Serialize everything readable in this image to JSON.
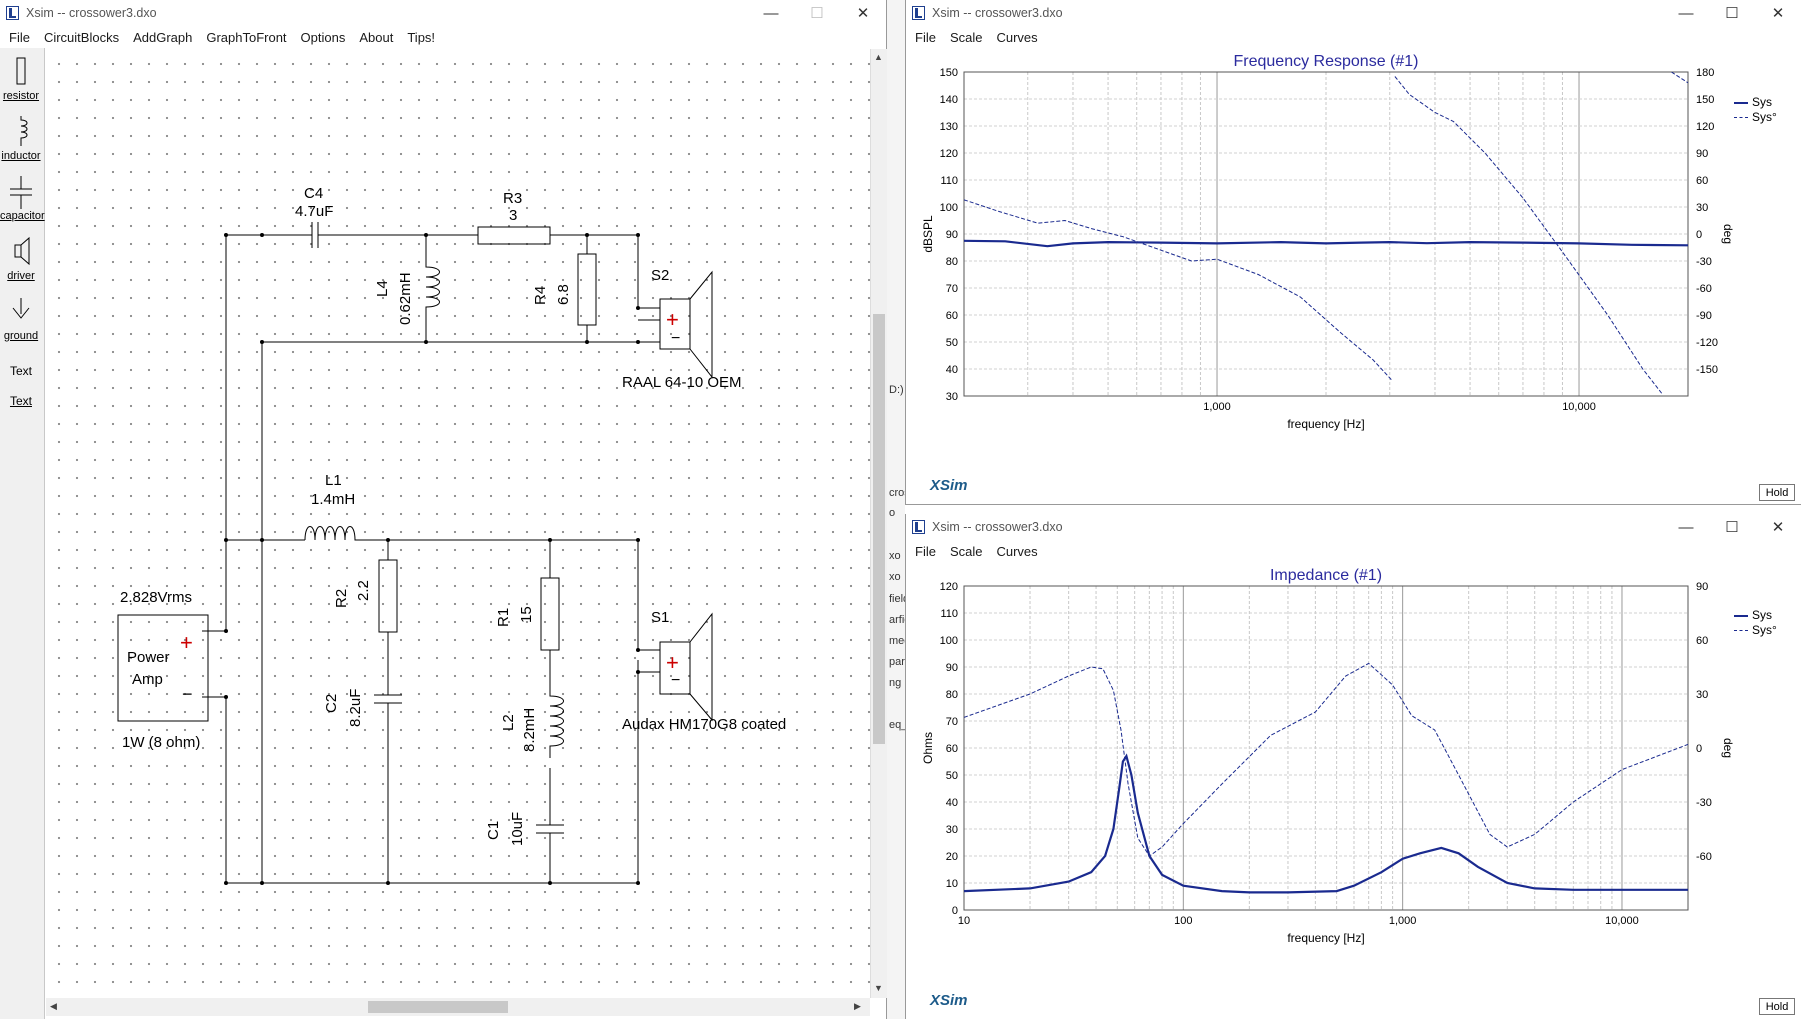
{
  "schematic_window": {
    "title": "Xsim -- crossower3.dxo",
    "menu": [
      "File",
      "CircuitBlocks",
      "AddGraph",
      "GraphToFront",
      "Options",
      "About",
      "Tips!"
    ],
    "toolbox": [
      {
        "label": "resistor",
        "icon": "resistor-icon"
      },
      {
        "label": "inductor",
        "icon": "inductor-icon"
      },
      {
        "label": "capacitor",
        "icon": "capacitor-icon"
      },
      {
        "label": "driver",
        "icon": "driver-icon"
      },
      {
        "label": "ground",
        "icon": "ground-icon"
      },
      {
        "label": "Text",
        "icon": "text-icon"
      },
      {
        "label": "Text",
        "icon": "text-link"
      }
    ],
    "components": {
      "c4_name": "C4",
      "c4_value": "4.7uF",
      "r3_name": "R3",
      "r3_value": "3",
      "l4_name": "L4",
      "l4_value": "0.62mH",
      "r4_name": "R4",
      "r4_value": "6.8",
      "s2_name": "S2",
      "s2_driver": "RAAL 64-10 OEM",
      "l1_name": "L1",
      "l1_value": "1.4mH",
      "r2_name": "R2",
      "r2_value": "2.2",
      "c2_name": "C2",
      "c2_value": "8.2uF",
      "r1_name": "R1",
      "r1_value": "15",
      "l2_name": "L2",
      "l2_value": "8.2mH",
      "c1_name": "C1",
      "c1_value": "10uF",
      "s1_name": "S1",
      "s1_driver": "Audax HM170G8 coated",
      "amp_voltage": "2.828Vrms",
      "amp_label1": "Power",
      "amp_label2": "Amp",
      "amp_power": "1W (8 ohm)",
      "plus": "+",
      "minus": "−"
    }
  },
  "background_strip": [
    "D:)",
    "cros",
    "o",
    "xo",
    "xo",
    "field",
    "arfie",
    "med",
    "para",
    "ng",
    "eq_n"
  ],
  "freq_window": {
    "title": "Xsim -- crossower3.dxo",
    "menu": [
      "File",
      "Scale",
      "Curves"
    ],
    "brand": "XSim",
    "hold_label": "Hold"
  },
  "imp_window": {
    "title": "Xsim -- crossower3.dxo",
    "menu": [
      "File",
      "Scale",
      "Curves"
    ],
    "brand": "XSim",
    "hold_label": "Hold"
  },
  "colors": {
    "curve": "#1a2a8f",
    "title": "#2b2b9e",
    "plus": "#cc0000"
  },
  "chart_data": [
    {
      "type": "line",
      "title": "Frequency Response (#1)",
      "xlabel": "frequency [Hz]",
      "ylabel": "dBSPL",
      "y2label": "deg",
      "xscale": "log",
      "xlim": [
        200,
        20000
      ],
      "ylim": [
        30,
        150
      ],
      "y2lim": [
        -180,
        180
      ],
      "x_tick_labels": [
        "1,000",
        "10,000"
      ],
      "y_ticks": [
        30,
        40,
        50,
        60,
        70,
        80,
        90,
        100,
        110,
        120,
        130,
        140,
        150
      ],
      "y2_ticks": [
        -150,
        -120,
        -90,
        -60,
        -30,
        0,
        30,
        60,
        90,
        120,
        150,
        180
      ],
      "legend_position": "top-right",
      "series": [
        {
          "name": "Sys",
          "axis": "left",
          "style": "solid",
          "x": [
            200,
            260,
            340,
            400,
            500,
            700,
            1000,
            1500,
            2000,
            2500,
            3000,
            3800,
            5000,
            7000,
            10000,
            14000,
            20000
          ],
          "y": [
            87.5,
            87.3,
            85.5,
            86.5,
            87,
            86.8,
            86.5,
            87,
            86.5,
            86.8,
            87,
            86.6,
            87,
            86.8,
            86.5,
            86,
            85.8
          ]
        },
        {
          "name": "Sys°",
          "axis": "right",
          "style": "dashed",
          "x": [
            200,
            250,
            320,
            380,
            450,
            550,
            700,
            850,
            1000,
            1300,
            1700,
            2200,
            2700,
            3050,
            3100,
            3400,
            4000,
            4500,
            5500,
            7000,
            9000,
            12000,
            15000,
            17000,
            18000,
            20000
          ],
          "y": [
            38,
            25,
            12,
            15,
            6,
            -3,
            -18,
            -30,
            -28,
            -45,
            -70,
            -110,
            -140,
            -163,
            175,
            155,
            135,
            125,
            90,
            40,
            -20,
            -90,
            -150,
            -178,
            180,
            168
          ]
        }
      ]
    },
    {
      "type": "line",
      "title": "Impedance (#1)",
      "xlabel": "frequency [Hz]",
      "ylabel": "Ohms",
      "y2label": "deg",
      "xscale": "log",
      "xlim": [
        10,
        20000
      ],
      "ylim": [
        0,
        120
      ],
      "y2lim": [
        -90,
        90
      ],
      "x_tick_labels": [
        "10",
        "100",
        "1,000",
        "10,000"
      ],
      "y_ticks": [
        0,
        10,
        20,
        30,
        40,
        50,
        60,
        70,
        80,
        90,
        100,
        110,
        120
      ],
      "y2_ticks": [
        -60,
        -30,
        0,
        30,
        60,
        90
      ],
      "legend_position": "top-right",
      "series": [
        {
          "name": "Sys",
          "axis": "left",
          "style": "solid",
          "x": [
            10,
            20,
            30,
            38,
            44,
            48,
            51,
            53,
            55,
            58,
            62,
            70,
            80,
            100,
            150,
            200,
            300,
            500,
            600,
            800,
            1000,
            1200,
            1500,
            1800,
            2200,
            3000,
            4000,
            6000,
            10000,
            20000
          ],
          "y": [
            7,
            8,
            10.5,
            14,
            20,
            30,
            45,
            55,
            57,
            50,
            36,
            20,
            13,
            9,
            7,
            6.5,
            6.5,
            7,
            9,
            14,
            19,
            21,
            23,
            21,
            16,
            10,
            8,
            7.5,
            7.5,
            7.5
          ]
        },
        {
          "name": "Sys°",
          "axis": "right",
          "style": "dashed",
          "x": [
            10,
            20,
            30,
            38,
            43,
            48,
            52,
            56,
            62,
            70,
            80,
            100,
            150,
            250,
            400,
            550,
            700,
            900,
            1100,
            1400,
            1800,
            2500,
            3000,
            4000,
            6000,
            10000,
            20000
          ],
          "y": [
            17,
            30,
            40,
            45,
            44,
            32,
            10,
            -20,
            -50,
            -60,
            -55,
            -42,
            -20,
            7,
            20,
            40,
            47,
            35,
            18,
            10,
            -15,
            -48,
            -55,
            -48,
            -30,
            -12,
            2
          ]
        }
      ]
    }
  ]
}
